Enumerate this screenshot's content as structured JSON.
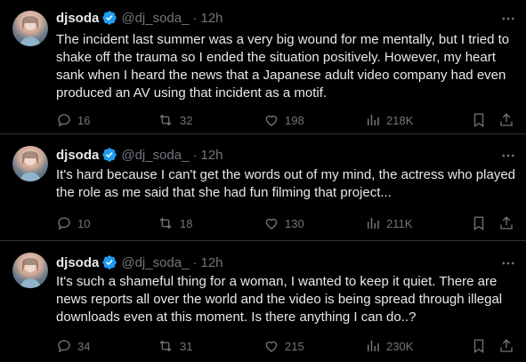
{
  "tweets": [
    {
      "name": "djsoda",
      "handle": "@dj_soda_",
      "separator": "·",
      "time": "12h",
      "text": "The incident last summer was a very big wound for me mentally, but I tried to shake off the trauma so I ended the situation positively. However, my heart sank when I heard the news that a Japanese adult video company had even produced an AV using that incident as a motif.",
      "replies": "16",
      "reposts": "32",
      "likes": "198",
      "views": "218K"
    },
    {
      "name": "djsoda",
      "handle": "@dj_soda_",
      "separator": "·",
      "time": "12h",
      "text": "It's hard because I can't get the words out of my mind, the actress who played the role as me said that she had fun filming that project...",
      "replies": "10",
      "reposts": "18",
      "likes": "130",
      "views": "211K"
    },
    {
      "name": "djsoda",
      "handle": "@dj_soda_",
      "separator": "·",
      "time": "12h",
      "text": "It's such a shameful thing for a woman, I wanted to keep it quiet. There are news reports all over the world and the video is being spread through illegal downloads even at this moment. Is there anything I can do..?",
      "replies": "34",
      "reposts": "31",
      "likes": "215",
      "views": "230K"
    }
  ],
  "icons": {
    "verified": "verified-badge-icon",
    "more": "more-icon",
    "reply": "reply-icon",
    "repost": "repost-icon",
    "like": "like-icon",
    "views": "views-icon",
    "bookmark": "bookmark-icon",
    "share": "share-icon"
  },
  "colors": {
    "background": "#000000",
    "text": "#e7e9ea",
    "muted": "#71767b",
    "verified": "#1d9bf0",
    "divider": "#2f3336"
  }
}
